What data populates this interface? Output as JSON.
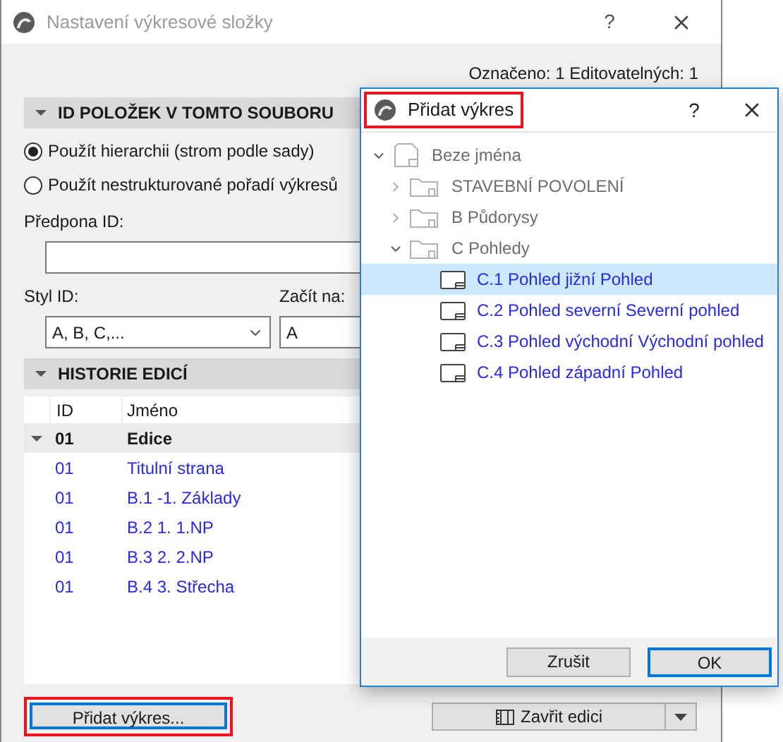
{
  "main_window": {
    "title": "Nastavení výkresové složky",
    "help": "?"
  },
  "status": "Označeno: 1 Editovatelných: 1",
  "id_section": {
    "title": "ID POLOŽEK V TOMTO SOUBORU",
    "expanded": true,
    "options": [
      {
        "label": "Použít hierarchii (strom podle sady)",
        "selected": true
      },
      {
        "label": "Použít nestrukturované pořadí výkresů",
        "selected": false
      }
    ],
    "prefix_label": "Předpona ID:",
    "style_label": "Styl ID:",
    "style_value": "A, B, C,...",
    "start_label": "Začít na:",
    "start_value": "A"
  },
  "history_section": {
    "title": "HISTORIE EDICÍ",
    "expanded": true,
    "columns": [
      "ID",
      "Jméno"
    ],
    "rows": [
      {
        "id": "01",
        "name": "Edice",
        "kind": "group",
        "expanded": true
      },
      {
        "id": "01",
        "name": "Titulní strana",
        "kind": "item"
      },
      {
        "id": "01",
        "name": "B.1 -1. Základy",
        "kind": "item"
      },
      {
        "id": "01",
        "name": "B.2 1. 1.NP",
        "kind": "item"
      },
      {
        "id": "01",
        "name": "B.3 2. 2.NP",
        "kind": "item"
      },
      {
        "id": "01",
        "name": "B.4 3. Střecha",
        "kind": "item"
      }
    ]
  },
  "add_button": {
    "label": "Přidat výkres...",
    "highlighted": true
  },
  "close_edition_button": "Zavřit edici",
  "dialog": {
    "title": "Přidat výkres",
    "title_highlighted": true,
    "help": "?",
    "tree": [
      {
        "label": "Beze jména",
        "kind": "root",
        "expanded": true,
        "selected": false,
        "children": [
          {
            "label": "STAVEBNÍ POVOLENÍ",
            "kind": "folder",
            "expanded": false,
            "selected": false
          },
          {
            "label": "B Půdorysy",
            "kind": "folder",
            "expanded": false,
            "selected": false
          },
          {
            "label": "C Pohledy",
            "kind": "folder",
            "expanded": true,
            "selected": false,
            "children": [
              {
                "label": "C.1 Pohled jižní Pohled",
                "kind": "drawing",
                "selected": true
              },
              {
                "label": "C.2 Pohled severní Severní pohled",
                "kind": "drawing",
                "selected": false
              },
              {
                "label": "C.3 Pohled východní Východní pohled",
                "kind": "drawing",
                "selected": false
              },
              {
                "label": "C.4 Pohled západní Pohled",
                "kind": "drawing",
                "selected": false
              }
            ]
          }
        ]
      }
    ],
    "buttons": [
      {
        "label": "Zrušit",
        "default": false
      },
      {
        "label": "OK",
        "default": true
      }
    ]
  }
}
